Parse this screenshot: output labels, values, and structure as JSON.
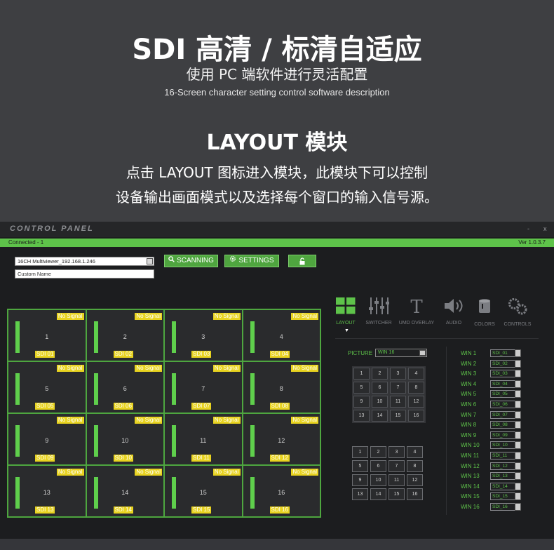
{
  "header": {
    "title": "SDI 高清 / 标清自适应",
    "subtitle": "使用 PC 端软件进行灵活配置",
    "subtitle_en": "16-Screen character setting control software description",
    "section_title": "LAYOUT 模块",
    "desc_line1": "点击 LAYOUT 图标进入模块，此模块下可以控制",
    "desc_line2": "设备输出画面模式以及选择每个窗口的输入信号源。"
  },
  "app": {
    "logo": "CONTROL PANEL",
    "min_label": "-",
    "close_label": "x",
    "status": "Connected - 1",
    "version": "Ver 1.0.3.7",
    "device": "16CH Multiviewer_192.168.1.246",
    "custom_name": "Custom Name",
    "buttons": {
      "scanning": "SCANNING",
      "settings": "SETTINGS"
    },
    "no_signal": "No Signal",
    "cells": [
      {
        "num": "1",
        "sdi": "SDI 01"
      },
      {
        "num": "2",
        "sdi": "SDI 02"
      },
      {
        "num": "3",
        "sdi": "SDI 03"
      },
      {
        "num": "4",
        "sdi": "SDI 04"
      },
      {
        "num": "5",
        "sdi": "SDI 05"
      },
      {
        "num": "6",
        "sdi": "SDI 06"
      },
      {
        "num": "7",
        "sdi": "SDI 07"
      },
      {
        "num": "8",
        "sdi": "SDI 08"
      },
      {
        "num": "9",
        "sdi": "SDI 09"
      },
      {
        "num": "10",
        "sdi": "SDI 10"
      },
      {
        "num": "11",
        "sdi": "SDI 11"
      },
      {
        "num": "12",
        "sdi": "SDI 12"
      },
      {
        "num": "13",
        "sdi": "SDI 13"
      },
      {
        "num": "14",
        "sdi": "SDI 14"
      },
      {
        "num": "15",
        "sdi": "SDI 15"
      },
      {
        "num": "16",
        "sdi": "SDI 16"
      }
    ],
    "tabs": [
      "LAYOUT",
      "SWITCHER",
      "UMD OVERLAY",
      "AUDIO",
      "COLORS",
      "CONTROLS"
    ],
    "picture_label": "PICTURE",
    "picture_value": "WIN 16",
    "picture_grid1": [
      "1",
      "2",
      "3",
      "4",
      "5",
      "6",
      "7",
      "8",
      "9",
      "10",
      "11",
      "12",
      "13",
      "14",
      "15",
      "16"
    ],
    "picture_grid2": [
      "1",
      "2",
      "3",
      "4",
      "5",
      "6",
      "7",
      "8",
      "9",
      "10",
      "11",
      "12",
      "13",
      "14",
      "15",
      "16"
    ],
    "windows": [
      {
        "label": "WIN 1",
        "src": "SDI_01"
      },
      {
        "label": "WIN 2",
        "src": "SDI_02"
      },
      {
        "label": "WIN 3",
        "src": "SDI_03"
      },
      {
        "label": "WIN 4",
        "src": "SDI_04"
      },
      {
        "label": "WIN 5",
        "src": "SDI_05"
      },
      {
        "label": "WIN 6",
        "src": "SDI_06"
      },
      {
        "label": "WIN 7",
        "src": "SDI_07"
      },
      {
        "label": "WIN 8",
        "src": "SDI_08"
      },
      {
        "label": "WIN 9",
        "src": "SDI_09"
      },
      {
        "label": "WIN 10",
        "src": "SDI_10"
      },
      {
        "label": "WIN 11",
        "src": "SDI_11"
      },
      {
        "label": "WIN 12",
        "src": "SDI_12"
      },
      {
        "label": "WIN 13",
        "src": "SDI_13"
      },
      {
        "label": "WIN 14",
        "src": "SDI_14"
      },
      {
        "label": "WIN 15",
        "src": "SDI_15"
      },
      {
        "label": "WIN 16",
        "src": "SDI_16"
      }
    ],
    "colors": {
      "accent": "#5ec34a",
      "signal_label": "#e8d320",
      "background": "#1c1d1f"
    }
  }
}
